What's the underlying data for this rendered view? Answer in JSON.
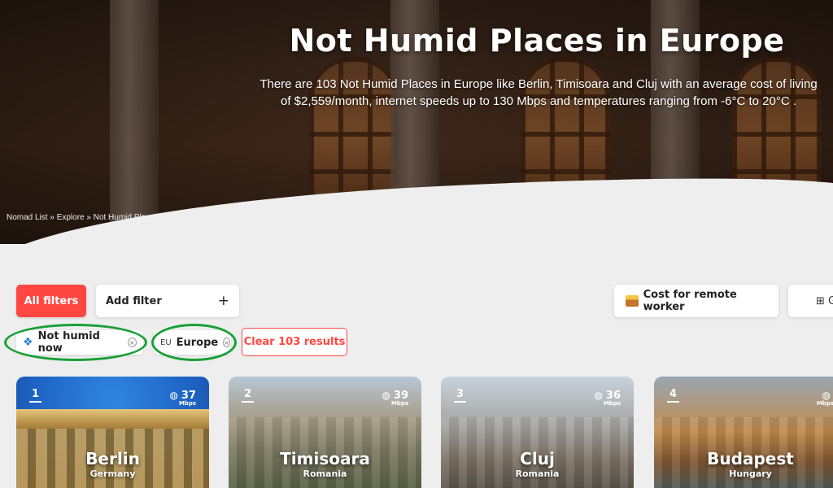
{
  "hero": {
    "title": "Not Humid Places in Europe",
    "description": "There are 103 Not Humid Places in Europe like Berlin, Timisoara and Cluj with an average cost of living of $2,559/month, internet speeds up to 130 Mbps and temperatures ranging from -6°C to 20°C .",
    "breadcrumb": "Nomad List » Explore » Not Humid Places in Europe"
  },
  "filters": {
    "all_filters_label": "All filters",
    "add_filter_label": "Add filter",
    "add_filter_icon": "+",
    "sort_label": "Cost for remote worker",
    "sort_icon": "cost-icon",
    "view_icon": "grid-icon",
    "view_label": "⊞ G",
    "chips": [
      {
        "label": "Not humid now",
        "icon": "water-drop-icon"
      },
      {
        "label": "Europe",
        "prefix": "EU"
      }
    ],
    "clear_label": "Clear 103 results",
    "chip_remove_glyph": "×",
    "highlight_color": "#17a035",
    "accent_color": "#ff4742"
  },
  "cards": [
    {
      "rank": "1",
      "city": "Berlin",
      "country": "Germany",
      "speed": "37",
      "unit": "Mbps"
    },
    {
      "rank": "2",
      "city": "Timisoara",
      "country": "Romania",
      "speed": "39",
      "unit": "Mbps"
    },
    {
      "rank": "3",
      "city": "Cluj",
      "country": "Romania",
      "speed": "36",
      "unit": "Mbps"
    },
    {
      "rank": "4",
      "city": "Budapest",
      "country": "Hungary",
      "speed": "",
      "unit": "Mbps"
    }
  ]
}
